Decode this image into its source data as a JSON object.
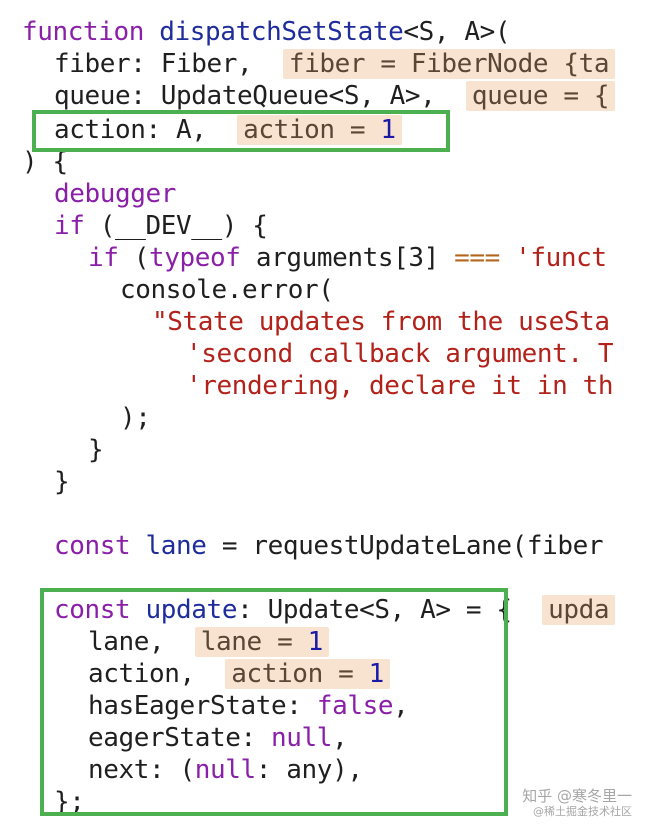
{
  "code": {
    "l1": {
      "kw": "function",
      "name": "dispatchSetState",
      "generic": "<S, A>("
    },
    "l2": {
      "text": "fiber: Fiber,",
      "ann": "fiber = FiberNode {ta"
    },
    "l3": {
      "text": "queue: UpdateQueue<S, A>,",
      "ann": "queue = {"
    },
    "l4": {
      "text": "action: A,",
      "ann_key": "action = ",
      "ann_val": "1"
    },
    "l5": {
      "text": ") {"
    },
    "l6": {
      "kw": "debugger"
    },
    "l7": {
      "kw": "if",
      "rest": " (__DEV__) {"
    },
    "l8": {
      "kw": "if",
      "paren": " (",
      "kw2": "typeof",
      "rest": " arguments[3] ",
      "op": "===",
      "str": " 'funct"
    },
    "l9": {
      "text": "console.error("
    },
    "l10": {
      "str": "\"State updates from the useSta"
    },
    "l11": {
      "str": "'second callback argument. T"
    },
    "l12": {
      "str": "'rendering, declare it in th"
    },
    "l13": {
      "text": ");"
    },
    "l14": {
      "text": "}"
    },
    "l15": {
      "text": "}"
    },
    "l16": {
      "kw": "const",
      "name": "lane",
      "rest": " = requestUpdateLane(fiber"
    },
    "l17": {
      "kw": "const",
      "name": "update",
      "rest": ": Update<S, A> = {",
      "ann": "upda"
    },
    "l18": {
      "text": "lane,",
      "ann_key": "lane = ",
      "ann_val": "1"
    },
    "l19": {
      "text": "action,",
      "ann_key": "action = ",
      "ann_val": "1"
    },
    "l20": {
      "text": "hasEagerState: ",
      "lit": "false",
      "tail": ","
    },
    "l21": {
      "text": "eagerState: ",
      "lit": "null",
      "tail": ","
    },
    "l22": {
      "text": "next: (",
      "lit": "null",
      "tail": ": any),"
    },
    "l23": {
      "text": "};"
    }
  },
  "watermark": {
    "line1": "知乎 @寒冬里一",
    "line2": "@稀土掘金技术社区"
  },
  "colors": {
    "highlight_box": "#4caf50",
    "annotation_bg": "#f8e3d1",
    "keyword": "#8a1fa8",
    "string": "#b2221b"
  }
}
